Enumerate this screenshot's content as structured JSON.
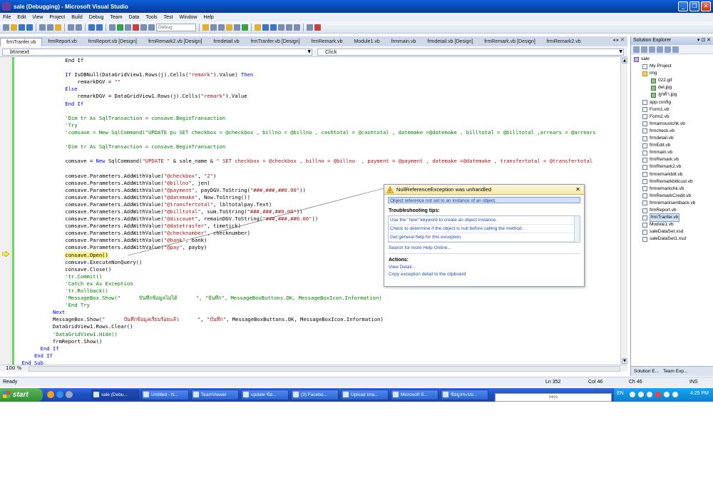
{
  "window": {
    "title": "sale (Debugging) - Microsoft Visual Studio"
  },
  "menu": [
    "File",
    "Edit",
    "View",
    "Project",
    "Build",
    "Debug",
    "Team",
    "Data",
    "Tools",
    "Test",
    "Window",
    "Help"
  ],
  "toolbar": {
    "config_combo": "Debug"
  },
  "doc_tabs": [
    "frmTranfer.vb",
    "frmReport.vb",
    "frmReport.vb [Design]",
    "frmRemark2.vb [Design]",
    "frmdetail.vb",
    "frmTranfer.vb [Design]",
    "frmRemark.vb",
    "Module1.vb",
    "frmmain.vb",
    "frmdetail.vb [Design]",
    "frmRemark.vb [Design]",
    "frmRemark2.vb"
  ],
  "active_tab": "frmTranfer.vb",
  "nav": {
    "left": "btnnext",
    "right": "Click"
  },
  "code_lines": [
    [
      [
        "",
        "                End If"
      ]
    ],
    [
      [
        "",
        " "
      ]
    ],
    [
      [
        "",
        "                "
      ],
      [
        "kw",
        "If"
      ],
      [
        "",
        " IsDBNull(DataGridView1.Rows(j).Cells("
      ],
      [
        "st",
        "\"remark\""
      ],
      [
        "",
        ").Value) "
      ],
      [
        "kw",
        "Then"
      ]
    ],
    [
      [
        "",
        "                    remarkDGV = "
      ],
      [
        "st",
        "\"\""
      ]
    ],
    [
      [
        "",
        "                "
      ],
      [
        "kw",
        "Else"
      ]
    ],
    [
      [
        "",
        "                    remarkDGV = DataGridView1.Rows(j).Cells("
      ],
      [
        "st",
        "\"remark\""
      ],
      [
        "",
        ").Value"
      ]
    ],
    [
      [
        "",
        "                "
      ],
      [
        "kw",
        "End If"
      ]
    ],
    [
      [
        "",
        " "
      ]
    ],
    [
      [
        "cm",
        "                'Dim tr As SqlTransaction = consave.BeginTransaction"
      ]
    ],
    [
      [
        "cm",
        "                'Try"
      ]
    ],
    [
      [
        "cm",
        "                'comsave = New SqlCommand(\"UPDATE pu SET checkbox = @checkbox , billno = @billno , cashtotal = @cashtotal , datemake =@datemake , billtotal = @billtotal ,arrears = @arrears"
      ]
    ],
    [
      [
        "",
        " "
      ]
    ],
    [
      [
        "cm",
        "                'Dim tr As SqlTransaction = consave.BeginTransaction"
      ]
    ],
    [
      [
        "",
        " "
      ]
    ],
    [
      [
        "",
        "                comsave = "
      ],
      [
        "kw",
        "New"
      ],
      [
        "",
        " SqlCommand("
      ],
      [
        "st",
        "\"UPDATE \""
      ],
      [
        "",
        " & sale_name & "
      ],
      [
        "st",
        "\" SET checkbox = @checkbox , billno = @billno  , payment = @payment , datemake =@datemake , transfertotal = @transfertotal"
      ]
    ],
    [
      [
        "",
        " "
      ]
    ],
    [
      [
        "",
        "                comsave.Parameters.AddWithValue("
      ],
      [
        "st",
        "\"@checkbox\""
      ],
      [
        "",
        ", "
      ],
      [
        "st",
        "\"2\""
      ],
      [
        "",
        ")"
      ]
    ],
    [
      [
        "",
        "                comsave.Parameters.AddWithValue("
      ],
      [
        "st",
        "\"@billno\""
      ],
      [
        "",
        ", jen)"
      ]
    ],
    [
      [
        "",
        "                comsave.Parameters.AddWithValue("
      ],
      [
        "st",
        "\"@payment\""
      ],
      [
        "",
        ", payDGV.ToString("
      ],
      [
        "st",
        "\"###,###,##0.00\""
      ],
      [
        "",
        "))"
      ]
    ],
    [
      [
        "",
        "                comsave.Parameters.AddWithValue("
      ],
      [
        "st",
        "\"@datemake\""
      ],
      [
        "",
        ", Now.ToString())"
      ]
    ],
    [
      [
        "",
        "                comsave.Parameters.AddWithValue("
      ],
      [
        "st",
        "\"@transfertotal\""
      ],
      [
        "",
        ", lbltotalpay.Text)"
      ]
    ],
    [
      [
        "",
        "                comsave.Parameters.AddWithValue("
      ],
      [
        "st",
        "\"@billtotal\""
      ],
      [
        "",
        ", sum.ToString("
      ],
      [
        "st",
        "\"###,###,##0.00\""
      ],
      [
        "",
        "))"
      ]
    ],
    [
      [
        "",
        "                comsave.Parameters.AddWithValue("
      ],
      [
        "st",
        "\"@discount\""
      ],
      [
        "",
        ", remainDGV.ToString("
      ],
      [
        "st",
        "\"###,###,##0.00\""
      ],
      [
        "",
        "))"
      ]
    ],
    [
      [
        "",
        "                comsave.Parameters.AddWithValue("
      ],
      [
        "st",
        "\"@datetrasfer\""
      ],
      [
        "",
        ", timetick)"
      ]
    ],
    [
      [
        "",
        "                comsave.Parameters.AddWithValue("
      ],
      [
        "st",
        "\"@checknumber\""
      ],
      [
        "",
        ", checknumber)"
      ]
    ],
    [
      [
        "",
        "                comsave.Parameters.AddWithValue("
      ],
      [
        "st",
        "\"@bank\""
      ],
      [
        "",
        ", bank)"
      ]
    ],
    [
      [
        "",
        "                comsave.Parameters.AddWithValue("
      ],
      [
        "st",
        "\"@pay\""
      ],
      [
        "",
        ", payby)"
      ]
    ],
    [
      [
        "",
        "                "
      ],
      [
        "hl",
        "consave.Open()"
      ]
    ],
    [
      [
        "",
        "                comsave.ExecuteNonQuery()"
      ]
    ],
    [
      [
        "",
        "                consave.Close()"
      ]
    ],
    [
      [
        "cm",
        "                'tr.Commit()"
      ]
    ],
    [
      [
        "cm",
        "                'Catch ex As Exception"
      ]
    ],
    [
      [
        "cm",
        "                'tr.Rollback()"
      ]
    ],
    [
      [
        "cm",
        "                'MessageBox.Show(\"      บันทึกข้อมูลไม่ได้      \", \"บันทึก\", MessageBoxButtons.OK, MessageBoxIcon.Information)"
      ]
    ],
    [
      [
        "cm",
        "                'End Try"
      ]
    ],
    [
      [
        "",
        "            "
      ],
      [
        "kw",
        "Next"
      ]
    ],
    [
      [
        "",
        "            MessageBox.Show("
      ],
      [
        "st",
        "\"      บันทึกข้อมูลเรียบร้อยแล้ว      \""
      ],
      [
        "",
        ", "
      ],
      [
        "st",
        "\"บันทึก\""
      ],
      [
        "",
        ", MessageBoxButtons.OK, MessageBoxIcon.Information)"
      ]
    ],
    [
      [
        "",
        "            DataGridView1.Rows.Clear()"
      ]
    ],
    [
      [
        "cm",
        "            'DataGridView1.Hide()"
      ]
    ],
    [
      [
        "",
        "            frmReport.Show()"
      ]
    ],
    [
      [
        "",
        "        "
      ],
      [
        "kw",
        "End If"
      ]
    ],
    [
      [
        "",
        "      "
      ],
      [
        "kw",
        "End If"
      ]
    ],
    [
      [
        "",
        "  "
      ],
      [
        "kw",
        "End Sub"
      ]
    ]
  ],
  "zoom": "100 %",
  "exception": {
    "title": "NullReferenceException was unhandled",
    "message": "Object reference not set to an instance of an object.",
    "tips_header": "Troubleshooting tips:",
    "tips": [
      "Use the \"new\" keyword to create an object instance.",
      "Check to determine if the object is null before calling the method.",
      "Get general help for this exception."
    ],
    "search_link": "Search for more Help Online...",
    "actions_header": "Actions:",
    "actions": [
      "View Detail...",
      "Copy exception detail to the clipboard"
    ]
  },
  "solution_explorer": {
    "title": "Solution Explorer",
    "tree": [
      {
        "label": "sale",
        "indent": 0,
        "kind": "sol"
      },
      {
        "label": "My Project",
        "indent": 1,
        "kind": "file"
      },
      {
        "label": "img",
        "indent": 1,
        "kind": "folder"
      },
      {
        "label": "022.gif",
        "indent": 2,
        "kind": "img"
      },
      {
        "label": "del.jpg",
        "indent": 2,
        "kind": "img"
      },
      {
        "label": "ลูกค้า.jpg",
        "indent": 2,
        "kind": "img"
      },
      {
        "label": "app.config",
        "indent": 1,
        "kind": "file"
      },
      {
        "label": "Form1.vb",
        "indent": 1,
        "kind": "file"
      },
      {
        "label": "Form2.vb",
        "indent": 1,
        "kind": "file"
      },
      {
        "label": "frmamountchk.vb",
        "indent": 1,
        "kind": "file"
      },
      {
        "label": "frmcheck.vb",
        "indent": 1,
        "kind": "file"
      },
      {
        "label": "frmdetail.vb",
        "indent": 1,
        "kind": "file"
      },
      {
        "label": "frmEdit.vb",
        "indent": 1,
        "kind": "file"
      },
      {
        "label": "frmmain.vb",
        "indent": 1,
        "kind": "file"
      },
      {
        "label": "frmRemark.vb",
        "indent": 1,
        "kind": "file"
      },
      {
        "label": "frmRemark2.vb",
        "indent": 1,
        "kind": "file"
      },
      {
        "label": "frmremarkbill.vb",
        "indent": 1,
        "kind": "file"
      },
      {
        "label": "frmRemarkbillcust.vb",
        "indent": 1,
        "kind": "file"
      },
      {
        "label": "frmremarkchk.vb",
        "indent": 1,
        "kind": "file"
      },
      {
        "label": "frmRemarkCredit.vb",
        "indent": 1,
        "kind": "file"
      },
      {
        "label": "frmremarksentback.vb",
        "indent": 1,
        "kind": "file"
      },
      {
        "label": "frmReport.vb",
        "indent": 1,
        "kind": "file"
      },
      {
        "label": "frmTranfer.vb",
        "indent": 1,
        "kind": "file",
        "selected": true
      },
      {
        "label": "Module1.vb",
        "indent": 1,
        "kind": "file"
      },
      {
        "label": "saleDataSet.xsd",
        "indent": 1,
        "kind": "file"
      },
      {
        "label": "saleDataSet1.xsd",
        "indent": 1,
        "kind": "file"
      }
    ],
    "tabs": [
      "Solution E...",
      "Team Exp..."
    ]
  },
  "status": {
    "ready": "Ready",
    "ln": "Ln 352",
    "col": "Col 46",
    "ch": "Ch 46",
    "mode": "INS"
  },
  "taskbar": {
    "start": "start",
    "tasks": [
      "sale (Debu...",
      "Untitled - N...",
      "TeamViewer",
      "update ข้อ...",
      "(3) Facebo...",
      "Upload Ima...",
      "Microsoft S...",
      "ข้อมูลระบบ..."
    ],
    "active_task": 0,
    "lang": "EN",
    "clock": "4:25 PM",
    "nero": "nero"
  }
}
